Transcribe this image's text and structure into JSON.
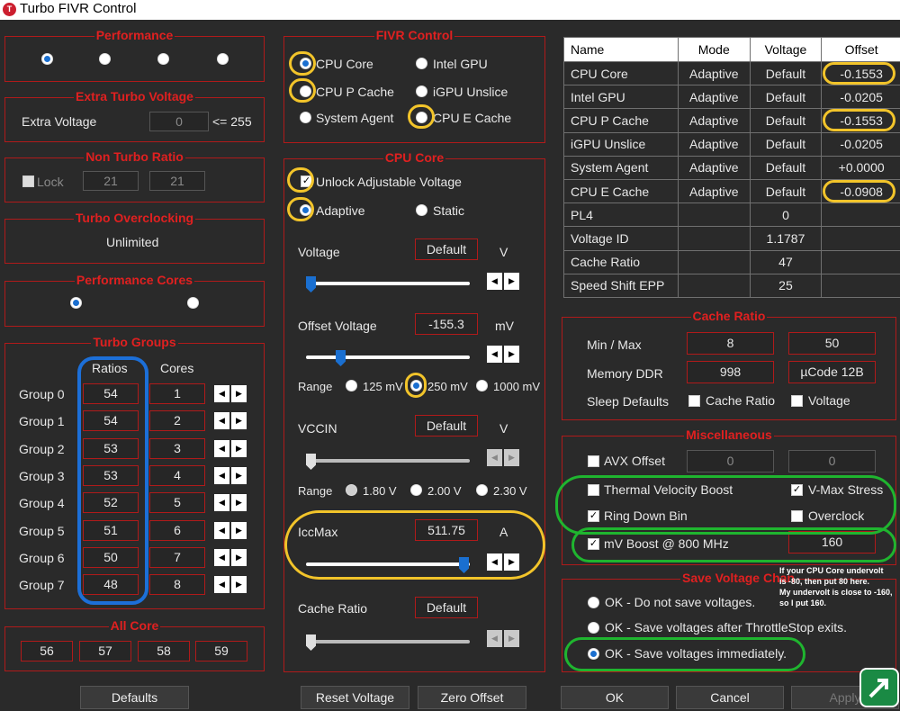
{
  "window": {
    "title": "Turbo FIVR Control",
    "logo_text": "T"
  },
  "performance": {
    "title": "Performance"
  },
  "extra_turbo": {
    "title": "Extra Turbo Voltage",
    "label": "Extra Voltage",
    "value": "0",
    "max_label": "<= 255"
  },
  "non_turbo": {
    "title": "Non Turbo Ratio",
    "lock_label": "Lock",
    "value1": "21",
    "value2": "21"
  },
  "turbo_oc": {
    "title": "Turbo Overclocking",
    "value": "Unlimited"
  },
  "perf_cores": {
    "title": "Performance Cores"
  },
  "turbo_groups": {
    "title": "Turbo Groups",
    "ratios_header": "Ratios",
    "cores_header": "Cores",
    "rows": [
      {
        "label": "Group 0",
        "ratio": "54",
        "cores": "1"
      },
      {
        "label": "Group 1",
        "ratio": "54",
        "cores": "2"
      },
      {
        "label": "Group 2",
        "ratio": "53",
        "cores": "3"
      },
      {
        "label": "Group 3",
        "ratio": "53",
        "cores": "4"
      },
      {
        "label": "Group 4",
        "ratio": "52",
        "cores": "5"
      },
      {
        "label": "Group 5",
        "ratio": "51",
        "cores": "6"
      },
      {
        "label": "Group 6",
        "ratio": "50",
        "cores": "7"
      },
      {
        "label": "Group 7",
        "ratio": "48",
        "cores": "8"
      }
    ]
  },
  "all_core": {
    "title": "All Core",
    "values": [
      "56",
      "57",
      "58",
      "59"
    ]
  },
  "fivr_control": {
    "title": "FIVR Control",
    "options": [
      "CPU Core",
      "Intel GPU",
      "CPU P Cache",
      "iGPU Unslice",
      "System Agent",
      "CPU E Cache"
    ]
  },
  "cpu_core": {
    "title": "CPU Core",
    "unlock_label": "Unlock Adjustable Voltage",
    "adaptive_label": "Adaptive",
    "static_label": "Static",
    "voltage_label": "Voltage",
    "voltage_value": "Default",
    "voltage_unit": "V",
    "offset_label": "Offset Voltage",
    "offset_value": "-155.3",
    "offset_unit": "mV",
    "range_label": "Range",
    "range_options": [
      "125 mV",
      "250 mV",
      "1000 mV"
    ],
    "vccin_label": "VCCIN",
    "vccin_value": "Default",
    "vccin_unit": "V",
    "vccin_range_label": "Range",
    "vccin_range_options": [
      "1.80 V",
      "2.00 V",
      "2.30 V"
    ],
    "iccmax_label": "IccMax",
    "iccmax_value": "511.75",
    "iccmax_unit": "A",
    "cache_ratio_label": "Cache Ratio",
    "cache_ratio_value": "Default"
  },
  "voltage_table": {
    "headers": [
      "Name",
      "Mode",
      "Voltage",
      "Offset"
    ],
    "rows": [
      [
        "CPU Core",
        "Adaptive",
        "Default",
        "-0.1553"
      ],
      [
        "Intel GPU",
        "Adaptive",
        "Default",
        "-0.0205"
      ],
      [
        "CPU P Cache",
        "Adaptive",
        "Default",
        "-0.1553"
      ],
      [
        "iGPU Unslice",
        "Adaptive",
        "Default",
        "-0.0205"
      ],
      [
        "System Agent",
        "Adaptive",
        "Default",
        "+0.0000"
      ],
      [
        "CPU E Cache",
        "Adaptive",
        "Default",
        "-0.0908"
      ],
      [
        "PL4",
        "",
        "0",
        ""
      ],
      [
        "Voltage ID",
        "",
        "1.1787",
        ""
      ],
      [
        "Cache Ratio",
        "",
        "47",
        ""
      ],
      [
        "Speed Shift EPP",
        "",
        "25",
        ""
      ]
    ]
  },
  "cache_ratio": {
    "title": "Cache Ratio",
    "minmax_label": "Min / Max",
    "min": "8",
    "max": "50",
    "memory_label": "Memory DDR",
    "memory_value": "998",
    "ucode_value": "µCode 12B",
    "sleep_label": "Sleep Defaults",
    "sleep_cache_label": "Cache Ratio",
    "sleep_voltage_label": "Voltage"
  },
  "misc": {
    "title": "Miscellaneous",
    "avx_label": "AVX Offset",
    "avx_value1": "0",
    "avx_value2": "0",
    "tvb_label": "Thermal Velocity Boost",
    "vmax_label": "V-Max Stress",
    "ringdown_label": "Ring Down Bin",
    "overclock_label": "Overclock",
    "mvboost_label": "mV Boost @ 800 MHz",
    "mvboost_value": "160"
  },
  "save_voltage": {
    "title": "Save Voltage Chan",
    "options": [
      "OK - Do not save voltages.",
      "OK - Save voltages after ThrottleStop exits.",
      "OK - Save voltages immediately."
    ],
    "note": "If your CPU Core undervolt\nis -80, then put 80 here.\nMy undervolt is close to -160,\nso I put 160."
  },
  "buttons": {
    "defaults": "Defaults",
    "reset_voltage": "Reset Voltage",
    "zero_offset": "Zero Offset",
    "ok": "OK",
    "cancel": "Cancel",
    "apply": "Apply"
  },
  "colors": {
    "accent": "#e02020",
    "highlight_yellow": "#f2c42a",
    "highlight_blue": "#1c6fd8",
    "highlight_green": "#1fb52f"
  }
}
